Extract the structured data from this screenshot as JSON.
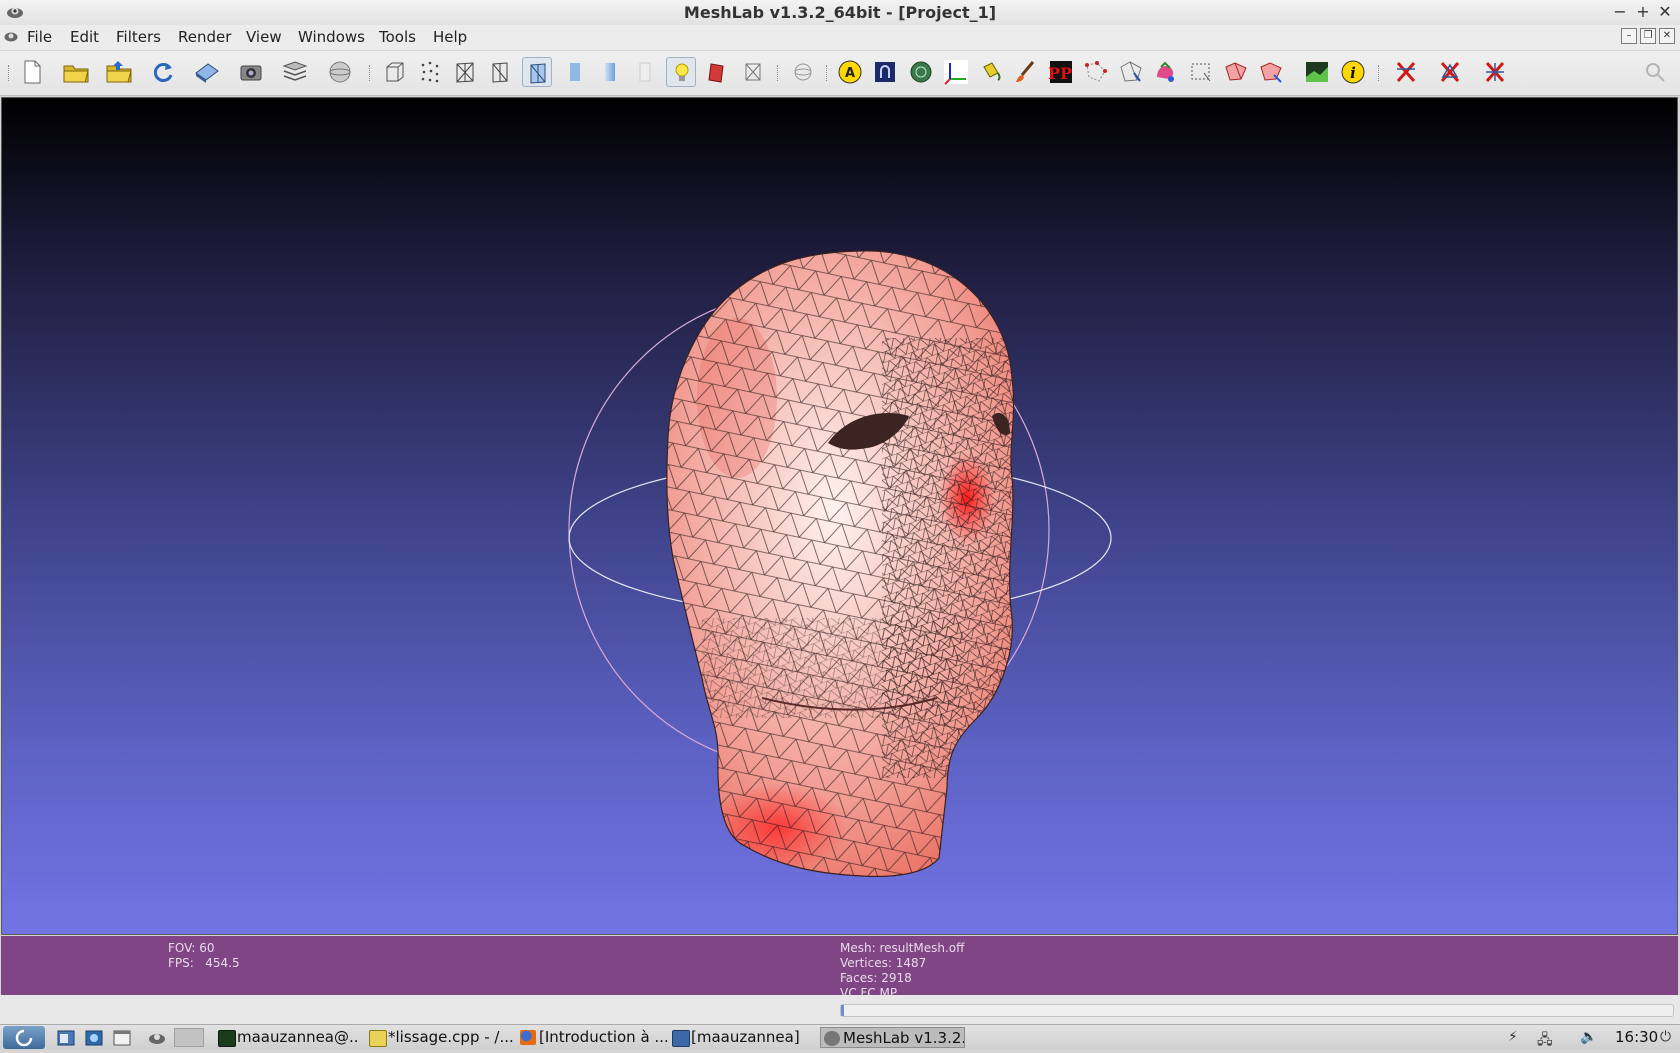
{
  "window": {
    "title": "MeshLab v1.3.2_64bit - [Project_1]",
    "controls": [
      "−",
      "+",
      "✕"
    ]
  },
  "menu": [
    "File",
    "Edit",
    "Filters",
    "Render",
    "View",
    "Windows",
    "Tools",
    "Help"
  ],
  "viewport": {
    "fov_text": "FOV: 60",
    "fps_text": "FPS:   454.5",
    "mesh_text": "Mesh: resultMesh.off",
    "vertices_text": "Vertices: 1487",
    "faces_text": "Faces: 2918",
    "flags_text": "VC FC MP"
  },
  "colors": {
    "background_top": "#000000",
    "background_bottom": "#7274e4",
    "info_bar": "#7f4585",
    "mesh_base": "#f2b6ae",
    "mesh_hot": "#ff2a2a"
  },
  "taskbar": {
    "items": [
      {
        "label": "maauzannea@...",
        "icon": "terminal-icon"
      },
      {
        "label": "*lissage.cpp - /...",
        "icon": "text-editor-icon"
      },
      {
        "label": "[Introduction à ...",
        "icon": "firefox-icon"
      },
      {
        "label": "[maauzannea]",
        "icon": "folder-icon"
      },
      {
        "label": "MeshLab v1.3.2...",
        "icon": "meshlab-icon"
      }
    ],
    "clock": "16:30"
  }
}
